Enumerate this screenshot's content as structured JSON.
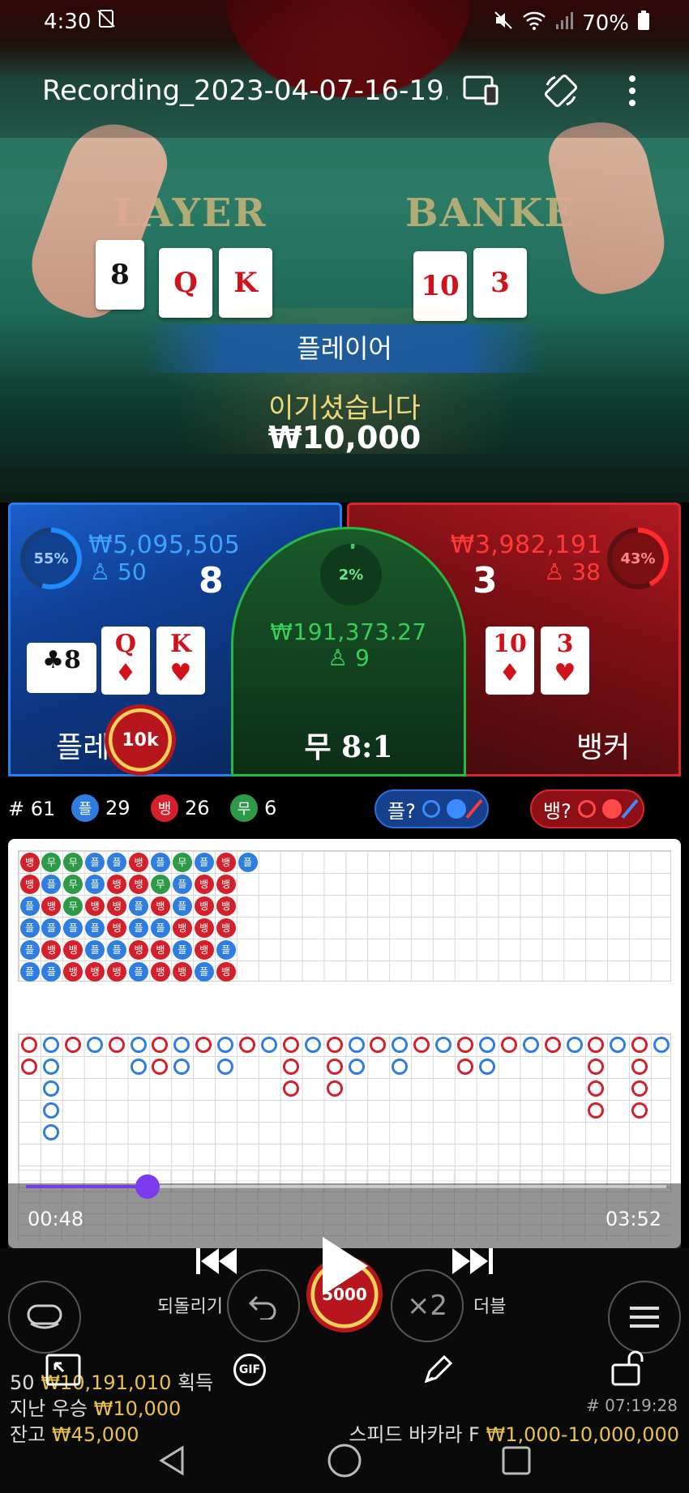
{
  "status_bar": {
    "time": "4:30",
    "battery": "70%"
  },
  "recording": {
    "title": "Recording_2023-04-07-16-19..."
  },
  "video": {
    "player_label": "LAYER",
    "banker_label": "BANKE",
    "player_cards": [
      "8",
      "Q",
      "K"
    ],
    "banker_cards": [
      "10",
      "3"
    ],
    "win_banner": "플레이어",
    "win_text": "이기셨습니다",
    "win_amount": "₩10,000"
  },
  "bets": {
    "player": {
      "pct": "55%",
      "amount": "₩5,095,505",
      "count": "50",
      "score": "8",
      "label": "플레이어",
      "cards": [
        {
          "rank": "8",
          "suit": "♣",
          "color": "black"
        },
        {
          "rank": "Q",
          "suit": "♦",
          "color": "red"
        },
        {
          "rank": "K",
          "suit": "♥",
          "color": "red"
        }
      ],
      "chip": "10k"
    },
    "tie": {
      "pct": "2%",
      "amount": "₩191,373.27",
      "count": "9",
      "label": "무 8:1"
    },
    "banker": {
      "pct": "43%",
      "amount": "₩3,982,191",
      "count": "38",
      "score": "3",
      "label": "뱅커",
      "cards": [
        {
          "rank": "10",
          "suit": "♦",
          "color": "red"
        },
        {
          "rank": "3",
          "suit": "♥",
          "color": "red"
        }
      ]
    }
  },
  "stats": {
    "round": "# 61",
    "player_label": "플",
    "player_count": "29",
    "banker_label": "뱅",
    "banker_count": "26",
    "tie_label": "무",
    "tie_count": "6",
    "player_ask": "플?",
    "banker_ask": "뱅?"
  },
  "bead_road": [
    [
      "뱅",
      "무",
      "무",
      "플",
      "플",
      "뱅",
      "플",
      "무",
      "플",
      "뱅",
      "플"
    ],
    [
      "뱅",
      "플",
      "무",
      "플",
      "뱅",
      "뱅",
      "무",
      "플",
      "뱅",
      "뱅"
    ],
    [
      "플",
      "뱅",
      "무",
      "뱅",
      "뱅",
      "플",
      "뱅",
      "플",
      "뱅",
      "뱅"
    ],
    [
      "플",
      "플",
      "플",
      "플",
      "뱅",
      "플",
      "플",
      "뱅",
      "뱅",
      "뱅"
    ],
    [
      "플",
      "뱅",
      "뱅",
      "플",
      "플",
      "뱅",
      "뱅",
      "플",
      "뱅",
      "플"
    ],
    [
      "플",
      "플",
      "뱅",
      "뱅",
      "뱅",
      "플",
      "뱅",
      "뱅",
      "플",
      "뱅"
    ]
  ],
  "colors": {
    "player": "#2f7de1",
    "banker": "#d4202a",
    "tie": "#2c9a47",
    "accent": "#7c3aed"
  },
  "media": {
    "time_current": "00:48",
    "time_total": "03:52",
    "progress": 0.19
  },
  "controls": {
    "undo_label": "되돌리기",
    "chip_value": "5000",
    "double_label": "더블",
    "x2": "×2"
  },
  "info": {
    "win_line_prefix": "50",
    "win_line_amount": "₩10,191,010",
    "win_line_suffix": "획득",
    "last_win_label": "지난 우승",
    "last_win_amount": "₩10,000",
    "balance_label": "잔고",
    "balance_amount": "₩45,000",
    "game_id": "# 07:19:28",
    "table_name": "스피드 바카라 F",
    "table_limits": "₩1,000-10,000,000"
  }
}
